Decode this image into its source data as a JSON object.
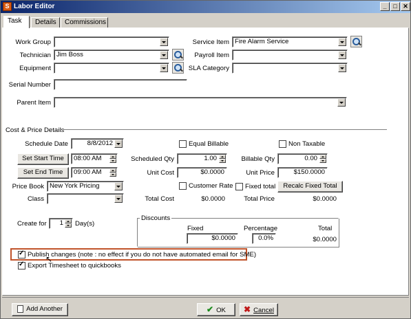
{
  "window": {
    "title": "Labor Editor",
    "app_icon": "app-icon"
  },
  "tabs": [
    {
      "label": "Task",
      "active": true
    },
    {
      "label": "Details"
    },
    {
      "label": "Commissions"
    }
  ],
  "labels": {
    "work_group": "Work Group",
    "technician": "Technician",
    "equipment": "Equipment",
    "serial_number": "Serial Number",
    "parent_item": "Parent Item",
    "service_item": "Service Item",
    "payroll_item": "Payroll Item",
    "sla_category": "SLA Category",
    "cost_price_details": "Cost & Price Details",
    "schedule_date": "Schedule Date",
    "price_book": "Price Book",
    "class": "Class",
    "scheduled_qty": "Scheduled Qty",
    "unit_cost": "Unit Cost",
    "total_cost": "Total Cost",
    "billable_qty": "Billable Qty",
    "unit_price": "Unit Price",
    "total_price": "Total Price",
    "create_for": "Create for",
    "days": "Day(s)",
    "discounts": "Discounts",
    "fixed": "Fixed",
    "percentage": "Percentage",
    "total": "Total"
  },
  "values": {
    "work_group": "",
    "technician": "Jim Boss",
    "equipment": "",
    "serial_number": "",
    "parent_item": "",
    "service_item": "Fire Alarm Service",
    "payroll_item": "",
    "sla_category": "",
    "schedule_date": "8/8/2012",
    "start_time": "08:00 AM",
    "end_time": "09:00 AM",
    "price_book": "New York Pricing",
    "class": "",
    "scheduled_qty": "1.00",
    "unit_cost": "$0.0000",
    "total_cost": "$0.0000",
    "billable_qty": "0.00",
    "unit_price": "$150.0000",
    "total_price": "$0.0000",
    "create_for": "1",
    "discount_fixed": "$0.0000",
    "discount_percentage": "0.0%",
    "discount_total": "$0.0000"
  },
  "buttons": {
    "set_start_time": "Set Start Time",
    "set_end_time": "Set End Time",
    "recalc_fixed_total": "Recalc Fixed Total",
    "add_another": "Add Another",
    "ok": "OK",
    "cancel": "Cancel"
  },
  "checkboxes": {
    "equal_billable": {
      "label": "Equal Billable",
      "checked": false
    },
    "non_taxable": {
      "label": "Non Taxable",
      "checked": false
    },
    "customer_rate": {
      "label": "Customer Rate",
      "checked": false
    },
    "fixed_total": {
      "label": "Fixed total",
      "checked": false
    },
    "publish_changes": {
      "label": "Publish changes (note : no effect if you do not have automated email for SME)",
      "checked": true
    },
    "export_timesheet": {
      "label": "Export Timesheet to quickbooks",
      "checked": true
    }
  },
  "colors": {
    "highlight": "#c0532a",
    "title_bar": "#0a246a"
  }
}
